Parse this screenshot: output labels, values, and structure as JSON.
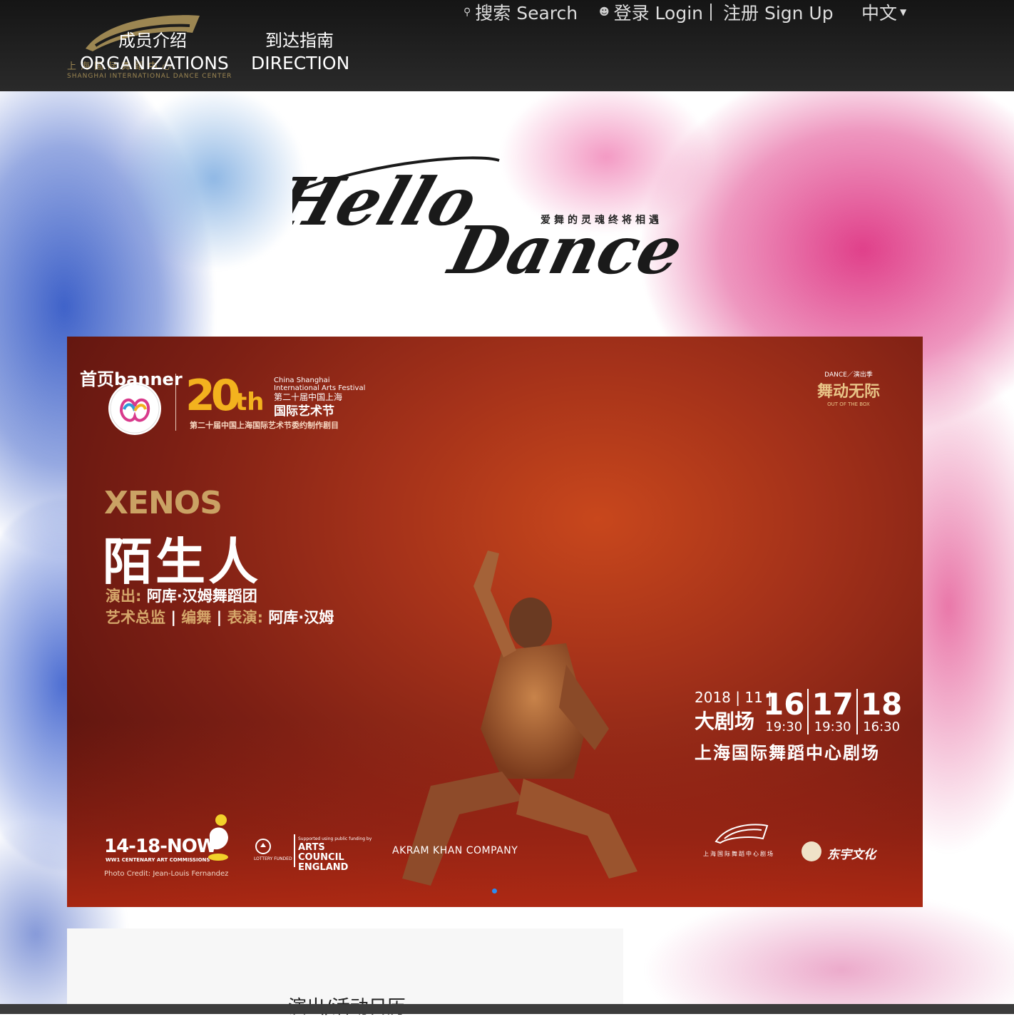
{
  "header": {
    "logo_cn": "上海国际舞蹈中心",
    "logo_en": "SHANGHAI INTERNATIONAL DANCE CENTER",
    "nav": [
      {
        "cn": "成员介绍",
        "en": "ORGANIZATIONS"
      },
      {
        "cn": "到达指南",
        "en": "DIRECTION"
      }
    ],
    "search_label": "搜索 Search",
    "login_label": "登录 Login",
    "signup_label": "注册 Sign Up",
    "language_label": "中文"
  },
  "hero": {
    "logo_text": "Hello Dance",
    "tagline": "爱舞的灵魂终将相遇"
  },
  "banner": {
    "label": "首页banner",
    "festival": {
      "number": "20",
      "suffix": "th",
      "name_en": "China Shanghai International Arts Festival",
      "name_cn_line1": "第二十届中国上海",
      "name_cn_line2": "国际艺术节",
      "subtitle": "第二十届中国上海国际艺术节委约制作剧目"
    },
    "dance_mark": {
      "line1": "DANCE／演出季",
      "line2": "舞动无际",
      "line3": "OUT OF THE BOX"
    },
    "show_en": "XENOS",
    "show_cn": "陌生人",
    "credit1_label": "演出:",
    "credit1_value": "阿库·汉姆舞蹈团",
    "credit2_label_a": "艺术总监",
    "credit2_label_b": "编舞",
    "credit2_label_c": "表演:",
    "credit2_sep": "|",
    "credit2_value": "阿库·汉姆",
    "date": {
      "year": "2018",
      "month": "11",
      "venue_short": "大剧场",
      "days": [
        {
          "day": "16",
          "time": "19:30"
        },
        {
          "day": "17",
          "time": "19:30"
        },
        {
          "day": "18",
          "time": "16:30"
        }
      ],
      "venue": "上海国际舞蹈中心剧场"
    },
    "footer": {
      "now_logo": "14-18-NOW",
      "now_sub": "WW1 CENTENARY ART COMMISSIONS",
      "photo_credit": "Photo Credit: Jean-Louis Fernandez",
      "lottery": "LOTTERY FUNDED",
      "arts_council_small": "Supported using public funding by",
      "arts_council": "ARTS COUNCIL ENGLAND",
      "company": "AKRAM KHAN COMPANY",
      "sidc_cn": "上海国际舞蹈中心剧场",
      "dongyu": "东宇文化"
    }
  },
  "panel": {
    "title": "演出/活动日历"
  },
  "colors": {
    "header_bg": "#1c1c1c",
    "gold": "#caa264",
    "banner_red": "#a5321a",
    "dot": "#2c8cf0"
  }
}
